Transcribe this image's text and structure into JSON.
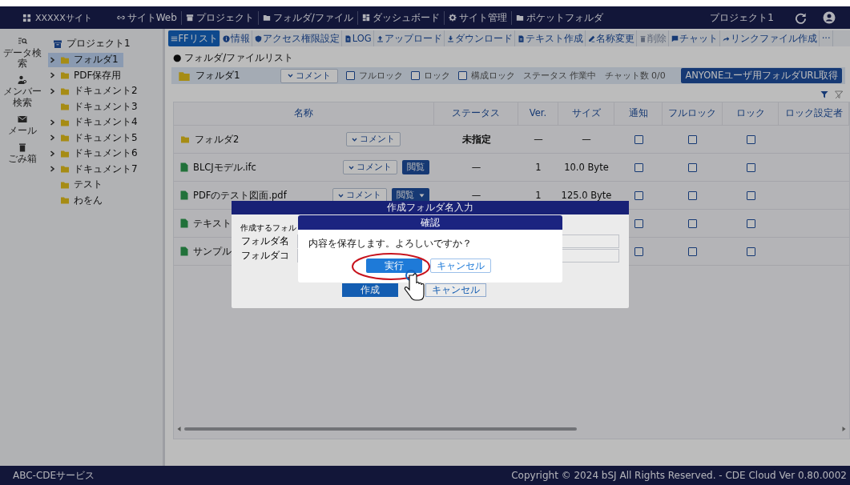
{
  "top_bar": {
    "site": "XXXXXサイト",
    "links": [
      {
        "label": "サイトWeb"
      },
      {
        "label": "プロジェクト"
      },
      {
        "label": "フォルダ/ファイル"
      },
      {
        "label": "ダッシュボード"
      },
      {
        "label": "サイト管理"
      },
      {
        "label": "ポケットフォルダ"
      }
    ],
    "project": "プロジェクト1"
  },
  "side_rail": [
    {
      "label": "データ検索"
    },
    {
      "label": "メンバー検索"
    },
    {
      "label": "メール"
    },
    {
      "label": "ごみ箱"
    }
  ],
  "tree": {
    "label": "プロジェクト1",
    "children": [
      {
        "label": "フォルダ1",
        "expandable": true,
        "selected": true
      },
      {
        "label": "PDF保存用",
        "expandable": true,
        "selected": false
      },
      {
        "label": "ドキュメント2",
        "expandable": true,
        "selected": false
      },
      {
        "label": "ドキュメント3",
        "expandable": false,
        "selected": false
      },
      {
        "label": "ドキュメント4",
        "expandable": true,
        "selected": false
      },
      {
        "label": "ドキュメント5",
        "expandable": true,
        "selected": false
      },
      {
        "label": "ドキュメント6",
        "expandable": true,
        "selected": false
      },
      {
        "label": "ドキュメント7",
        "expandable": true,
        "selected": false
      },
      {
        "label": "テスト",
        "expandable": false,
        "selected": false
      },
      {
        "label": "わをん",
        "expandable": false,
        "selected": false
      }
    ]
  },
  "toolbar": [
    {
      "label": "FFリスト",
      "selected": true,
      "disabled": false
    },
    {
      "label": "情報",
      "selected": false,
      "disabled": false
    },
    {
      "label": "アクセス権限設定",
      "selected": false,
      "disabled": false
    },
    {
      "label": "LOG",
      "selected": false,
      "disabled": false
    },
    {
      "label": "アップロード",
      "selected": false,
      "disabled": false
    },
    {
      "label": "ダウンロード",
      "selected": false,
      "disabled": false
    },
    {
      "label": "テキスト作成",
      "selected": false,
      "disabled": false
    },
    {
      "label": "名称変更",
      "selected": false,
      "disabled": false
    },
    {
      "label": "削除",
      "selected": false,
      "disabled": true
    },
    {
      "label": "チャット",
      "selected": false,
      "disabled": false
    },
    {
      "label": "リンクファイル作成",
      "selected": false,
      "disabled": false
    },
    {
      "label": "···",
      "selected": false,
      "disabled": false
    }
  ],
  "section_title": "● フォルダ/ファイルリスト",
  "folder_bar": {
    "name": "フォルダ1",
    "comment_button": "コメント",
    "locks": [
      {
        "label": "フルロック",
        "checked": false
      },
      {
        "label": "ロック",
        "checked": false
      },
      {
        "label": "構成ロック",
        "checked": false
      }
    ],
    "status": "ステータス 作業中",
    "chat_count": "チャット数 0/0",
    "url_button": "ANYONEユーザ用フォルダURL取得"
  },
  "table": {
    "columns": [
      "名称",
      "ステータス",
      "Ver.",
      "サイズ",
      "通知",
      "フルロック",
      "ロック",
      "ロック設定者"
    ],
    "rows": [
      {
        "kind": "folder",
        "name": "フォルダ2",
        "comment": "コメント",
        "status": "未指定",
        "ver": "—",
        "size": "—",
        "checks": [
          {
            "checked": false
          },
          {
            "checked": false
          },
          {
            "checked": false
          }
        ]
      },
      {
        "kind": "file",
        "name": "BLCJモデル.ifc",
        "comment": "コメント",
        "view": "閲覧",
        "view_menu": false,
        "status": "—",
        "ver": "1",
        "size": "10.0 Byte",
        "checks": [
          {
            "checked": false
          },
          {
            "checked": false
          },
          {
            "checked": false
          }
        ]
      },
      {
        "kind": "file",
        "name": "PDFのテスト図面.pdf",
        "comment": "コメント",
        "view": "閲覧",
        "view_menu": true,
        "status": "—",
        "ver": "1",
        "size": "125.0 Byte",
        "checks": [
          {
            "checked": false
          },
          {
            "checked": false
          },
          {
            "checked": false
          }
        ]
      },
      {
        "kind": "file",
        "name": "テキスト",
        "checks": [
          {
            "checked": false
          },
          {
            "checked": false
          },
          {
            "checked": false
          }
        ]
      },
      {
        "kind": "file",
        "name": "サンプル",
        "checks": [
          {
            "checked": false
          },
          {
            "checked": false
          },
          {
            "checked": false
          }
        ]
      }
    ]
  },
  "dialog": {
    "title": "作成フォルダ名入力",
    "prompt": "作成するフォル",
    "fields": [
      {
        "label": "フォルダ名"
      },
      {
        "label": "フォルダコ"
      }
    ],
    "buttons": [
      "作成",
      "キャンセル"
    ]
  },
  "confirm": {
    "title": "確認",
    "message": "内容を保存します。よろしいですか？",
    "buttons": [
      {
        "label": "実行",
        "kind": "primary"
      },
      {
        "label": "キャンセル",
        "kind": "secondary"
      }
    ]
  },
  "footer": {
    "left": "ABC-CDEサービス",
    "right": "Copyright © 2024 bSJ All Rights Reserved. - CDE Cloud Ver 0.80.0002"
  }
}
